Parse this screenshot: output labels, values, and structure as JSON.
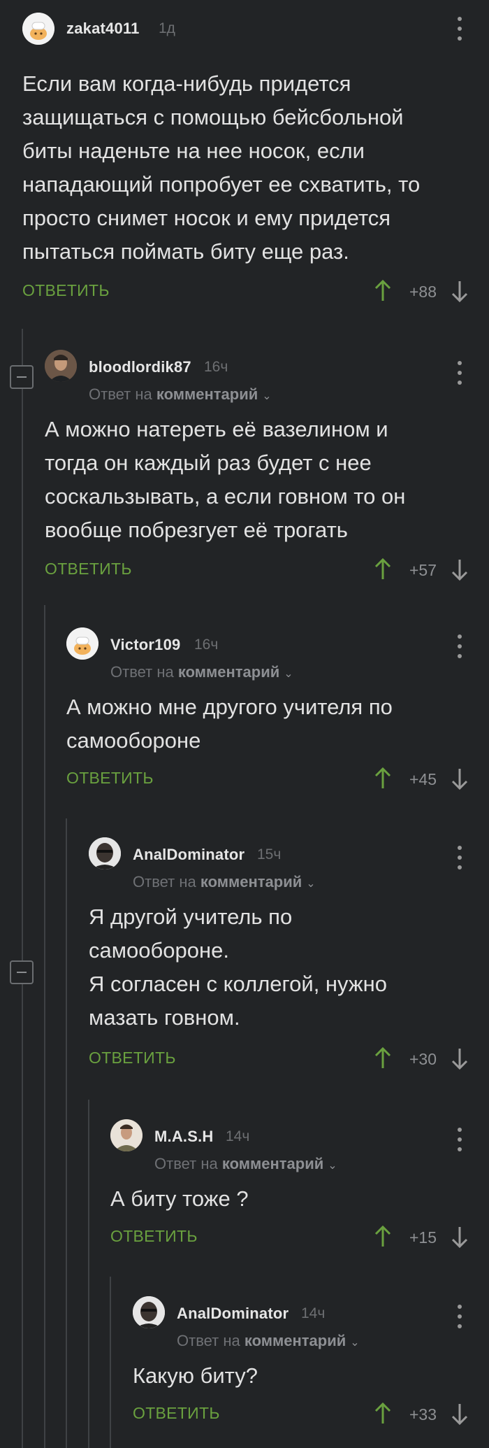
{
  "labels": {
    "reply": "ОТВЕТИТЬ",
    "reply_to_prefix": "Ответ на",
    "reply_to_target": "комментарий"
  },
  "colors": {
    "background": "#222426",
    "reply": "#6aa13f",
    "upvote": "#6aa13f",
    "downvote": "#9a9a9a"
  },
  "comments": [
    {
      "username": "zakat4011",
      "time": "1д",
      "avatar": "chef-hat-avatar",
      "text": "Если вам когда-нибудь придется\nзащищаться с помощью бейсбольной\nбиты наденьте на нее носок, если\nнападающий попробует ее схватить, то\nпросто снимет носок и ему придется\nпытаться поймать биту еще раз.",
      "score": "+88"
    },
    {
      "username": "bloodlordik87",
      "time": "16ч",
      "avatar": "user-photo-avatar",
      "text": "А можно натереть её вазелином и\nтогда он каждый раз будет с нее\nсоскальзывать, а если говном то он\nвообще побрезгует её трогать",
      "score": "+57"
    },
    {
      "username": "Victor109",
      "time": "16ч",
      "avatar": "chef-hat-avatar",
      "text": "А можно мне другого учителя по\nсамообороне",
      "score": "+45"
    },
    {
      "username": "AnalDominator",
      "time": "15ч",
      "avatar": "user-photo-avatar",
      "text": "Я другой учитель по\nсамообороне.\nЯ согласен с коллегой, нужно\nмазать говном.",
      "score": "+30"
    },
    {
      "username": "M.A.S.H",
      "time": "14ч",
      "avatar": "user-photo-avatar",
      "text": "А биту тоже ?",
      "score": "+15"
    },
    {
      "username": "AnalDominator",
      "time": "14ч",
      "avatar": "user-photo-avatar",
      "text": "Какую биту?",
      "score": "+33"
    }
  ]
}
